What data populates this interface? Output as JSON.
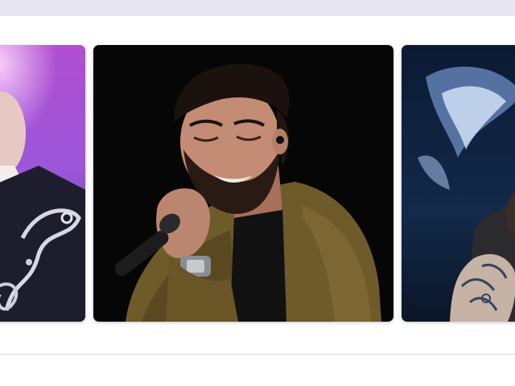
{
  "carousel": {
    "cards": [
      {
        "subject": "performer-in-embroidered-jacket"
      },
      {
        "subject": "singer-with-microphone"
      },
      {
        "subject": "performer-with-tattooed-arm"
      }
    ]
  },
  "colors": {
    "top_bar": "#e9e6f3",
    "top_bar_border": "#b9a8e6",
    "divider": "#d9d7df"
  }
}
